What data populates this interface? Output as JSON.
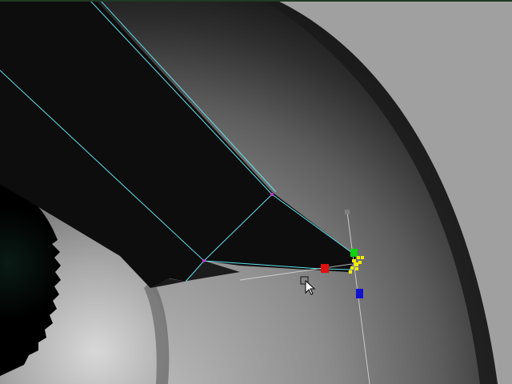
{
  "viewport": {
    "background_color": "#a0a0a0",
    "top_edge_color": "#1f3a26"
  },
  "scene": {
    "object_colors": {
      "dark_surface": "#0d0d0d",
      "gray_surface": "#a5a5a5",
      "shadow": "#3a3a3a",
      "wireframe": "#62e0ee",
      "selected_vertex": "#cc33cc",
      "manipulator_line": "#dddddd"
    },
    "manipulator": {
      "icon": "move-rotate-scale-manipulator",
      "handle_colors": {
        "x": "#e01010",
        "y": "#10d010",
        "z": "#1010d0",
        "center": "#f0f000",
        "pivot": "#808080"
      }
    },
    "cursor": {
      "icon": "arrow-cursor-with-select-box"
    }
  }
}
